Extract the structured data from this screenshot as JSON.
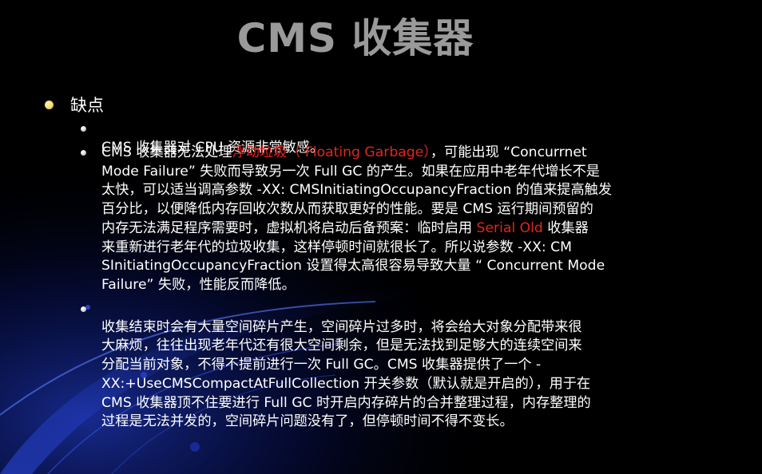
{
  "title": "CMS 收集器",
  "section": {
    "heading": "缺点"
  },
  "items": [
    {
      "parts": [
        {
          "text": "CMS 收集器对 CPU 资源非常敏感。"
        }
      ]
    },
    {
      "parts": [
        {
          "text": "CMS 收集器无法处理"
        },
        {
          "text": "浮动垃圾（ Floating Garbage）",
          "color": "red"
        },
        {
          "text": "，可能出现 “Concurrnet\nMode Failure” 失败而导致另一次 Full GC 的产生。如果在应用中老年代增长不是\n太快，可以适当调高参数 -XX: CMSInitiatingOccupancyFraction 的值来提高触发\n百分比，以便降低内存回收次数从而获取更好的性能。要是 CMS 运行期间预留的\n内存无法满足程序需要时，虚拟机将启动后备预案：临时启用 "
        },
        {
          "text": "Serial Old",
          "color": "red"
        },
        {
          "text": " 收集器\n来重新进行老年代的垃圾收集，这样停顿时间就很长了。所以说参数 -XX: CM\nSInitiatingOccupancyFraction 设置得太高很容易导致大量 “ Concurrent Mode\nFailure” 失败，性能反而降低。"
        }
      ]
    },
    {
      "parts": [
        {
          "text": "收集结束时会有大量空间碎片产生，空间碎片过多时，将会给大对象分配带来很\n大麻烦，往往出现老年代还有很大空间剩余，但是无法找到足够大的连续空间来\n分配当前对象，不得不提前进行一次 Full GC。CMS 收集器提供了一个 -\nXX:+UseCMSCompactAtFullCollection 开关参数（默认就是开启的），用于在\nCMS 收集器顶不住要进行 Full GC 时开启内存碎片的合并整理过程，内存整理的\n过程是无法并发的，空间碎片问题没有了，但停顿时间不得不变长。"
        }
      ]
    }
  ],
  "colors": {
    "background": "#000000",
    "title": "#9a9a9a",
    "text": "#ffffff",
    "accent": "#e0261e",
    "swirl": "#1b3fd6"
  },
  "icons": {
    "level1_bullet": "yellow-dot-bullet-icon",
    "level2_bullet": "white-dot-bullet-icon"
  }
}
